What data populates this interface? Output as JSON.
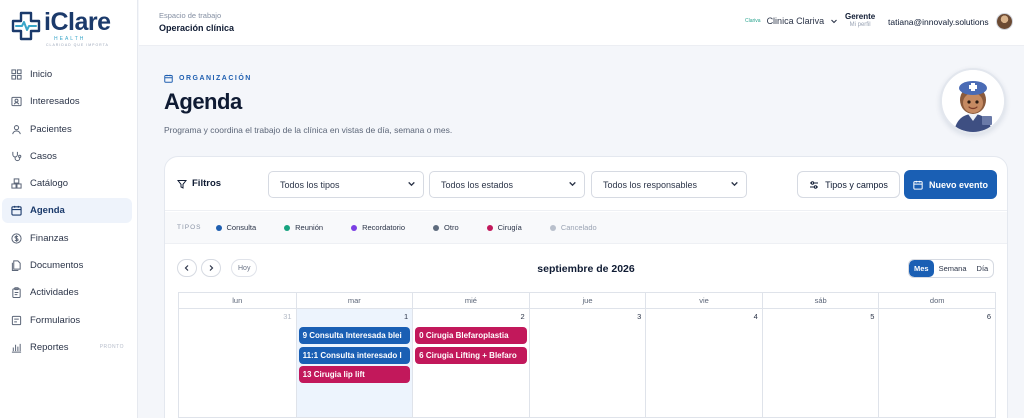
{
  "brand": {
    "name": "iClare",
    "sub": "HEALTH",
    "tagline": "CLARIDAD QUE IMPORTA"
  },
  "sidebar": {
    "items": [
      {
        "label": "Inicio",
        "icon": "grid-icon"
      },
      {
        "label": "Interesados",
        "icon": "id-card-icon"
      },
      {
        "label": "Pacientes",
        "icon": "user-icon"
      },
      {
        "label": "Casos",
        "icon": "stethoscope-icon"
      },
      {
        "label": "Catálogo",
        "icon": "boxes-icon"
      },
      {
        "label": "Agenda",
        "icon": "calendar-icon",
        "active": true
      },
      {
        "label": "Finanzas",
        "icon": "dollar-icon"
      },
      {
        "label": "Documentos",
        "icon": "documents-icon"
      },
      {
        "label": "Actividades",
        "icon": "clipboard-icon"
      },
      {
        "label": "Formularios",
        "icon": "form-icon"
      },
      {
        "label": "Reportes",
        "icon": "bar-chart-icon",
        "badge": "PRONTO"
      }
    ]
  },
  "topbar": {
    "workspace_label": "Espacio de trabajo",
    "workspace_value": "Operación clínica",
    "clinic_name": "Clinica Clariva",
    "clinic_mini": "Clariva",
    "role_name": "Gerente",
    "role_sub": "Mi perfil",
    "user_email": "tatiana@innovaly.solutions"
  },
  "header": {
    "eyebrow": "ORGANIZACIÓN",
    "title": "Agenda",
    "description": "Programa y coordina el trabajo de la clínica en vistas de día, semana o mes."
  },
  "filters": {
    "label": "Filtros",
    "types": "Todos los tipos",
    "states": "Todos los estados",
    "owners": "Todos los responsables",
    "fields_button": "Tipos y campos",
    "new_event_button": "Nuevo evento"
  },
  "legend": {
    "title": "TIPOS",
    "items": [
      {
        "label": "Consulta",
        "color": "#1f5fb0"
      },
      {
        "label": "Reunión",
        "color": "#17a37f"
      },
      {
        "label": "Recordatorio",
        "color": "#7b3fe4"
      },
      {
        "label": "Otro",
        "color": "#5e6b7d"
      },
      {
        "label": "Cirugía",
        "color": "#c2185b"
      },
      {
        "label": "Cancelado",
        "color": "#b9c0cc"
      }
    ]
  },
  "calendar": {
    "today_label": "Hoy",
    "title": "septiembre de 2026",
    "views": [
      "Mes",
      "Semana",
      "Día"
    ],
    "weekdays": [
      "lun",
      "mar",
      "mié",
      "jue",
      "vie",
      "sáb",
      "dom"
    ],
    "days": [
      "31",
      "1",
      "2",
      "3",
      "4",
      "5",
      "6"
    ],
    "events": {
      "tue": [
        {
          "time": "9",
          "title": "Consulta Interesada blei",
          "color": "#1a5fb4"
        },
        {
          "time": "11:1",
          "title": "Consulta interesado l",
          "color": "#1a5fb4"
        },
        {
          "time": "13",
          "title": "Cirugia lip lift",
          "color": "#c2185b"
        }
      ],
      "wed": [
        {
          "time": "0",
          "title": "Cirugia Blefaroplastia",
          "color": "#c2185b"
        },
        {
          "time": "6",
          "title": "Cirugia Lifting + Blefaro",
          "color": "#c2185b"
        }
      ]
    }
  }
}
